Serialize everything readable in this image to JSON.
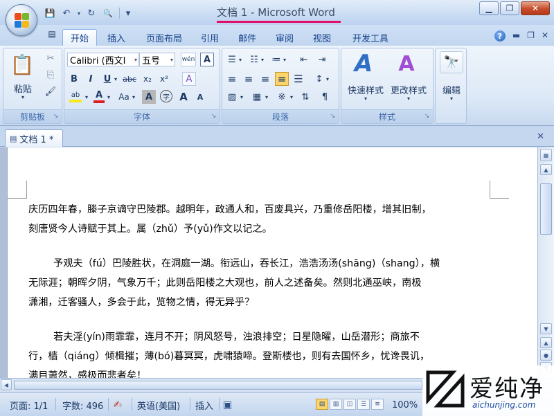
{
  "window": {
    "title": "文档 1 - Microsoft Word",
    "minimize": "▁",
    "restore": "❐",
    "close": "✕"
  },
  "qat": {
    "save": "💾",
    "undo": "↶",
    "redo": "↻",
    "print_preview": "🔍",
    "customize": "▾"
  },
  "tabs": [
    "开始",
    "插入",
    "页面布局",
    "引用",
    "邮件",
    "审阅",
    "视图",
    "开发工具"
  ],
  "ribbon": {
    "clipboard": {
      "label": "剪贴板",
      "paste": "粘贴",
      "paste_icon": "📋",
      "cut": "✂",
      "copy": "⎘",
      "format_painter": "🖌"
    },
    "font": {
      "label": "字体",
      "font_name": "Calibri (西文I",
      "font_size": "五号",
      "phonetic": "wén",
      "char_border": "A",
      "bold": "B",
      "italic": "I",
      "underline": "U",
      "strikethrough": "abc",
      "subscript": "x₂",
      "superscript": "x²",
      "clear_format": "A",
      "highlight": "ab",
      "font_color": "A",
      "change_case": "Aa",
      "char_shading": "A",
      "enclose": "字",
      "grow": "A",
      "shrink": "A"
    },
    "paragraph": {
      "label": "段落",
      "bullets": "☰",
      "numbering": "☷",
      "multilevel": "≔",
      "decrease_indent": "⇤",
      "increase_indent": "⇥",
      "align_left": "≡",
      "center": "≡",
      "align_right": "≡",
      "justify": "≡",
      "line_spacing": "↕",
      "shading": "▨",
      "borders": "▦",
      "asian_layout": "※",
      "sort": "⇅",
      "show_marks": "¶"
    },
    "styles": {
      "label": "样式",
      "quick_styles": "快速样式",
      "change_styles": "更改样式"
    },
    "editing": {
      "label": "编辑",
      "icon": "🔭"
    }
  },
  "doc_tab": {
    "label": "文档 1 *"
  },
  "document": {
    "lines": [
      "庆历四年春，滕子京谪守巴陵郡。越明年，政通人和，百废具兴，乃重修岳阳楼，增其旧制，",
      "刻唐贤今人诗赋于其上。属（zhǔ）予(yǔ)作文以记之。",
      "予观夫（fú）巴陵胜状，在洞庭一湖。衔远山，吞长江，浩浩汤汤(shāng)（shang），横",
      "无际涯；朝晖夕阴，气象万千；此则岳阳楼之大观也，前人之述备矣。然则北通巫峡，南极",
      "潇湘，迁客骚人，多会于此，览物之情，得无异乎？",
      "若夫淫(yín)雨霏霏，连月不开；阴风怒号，浊浪排空；日星隐曜，山岳潜形；商旅不",
      "行，樯（qiáng）倾楫摧；薄(bó)暮冥冥，虎啸猿啼。登斯楼也，则有去国怀乡，忧谗畏讥，",
      "满目萧然，感极而悲者矣！"
    ]
  },
  "statusbar": {
    "page": "页面: 1/1",
    "words": "字数: 496",
    "language": "英语(美国)",
    "insert_mode": "插入",
    "zoom": "100%"
  },
  "watermark": {
    "text": "爱纯净",
    "url": "aichunjing.com"
  },
  "colors": {
    "title_underline": "#e0106a",
    "font_color_bar": "#d91f1f",
    "highlight_bar": "#f7e91a"
  }
}
